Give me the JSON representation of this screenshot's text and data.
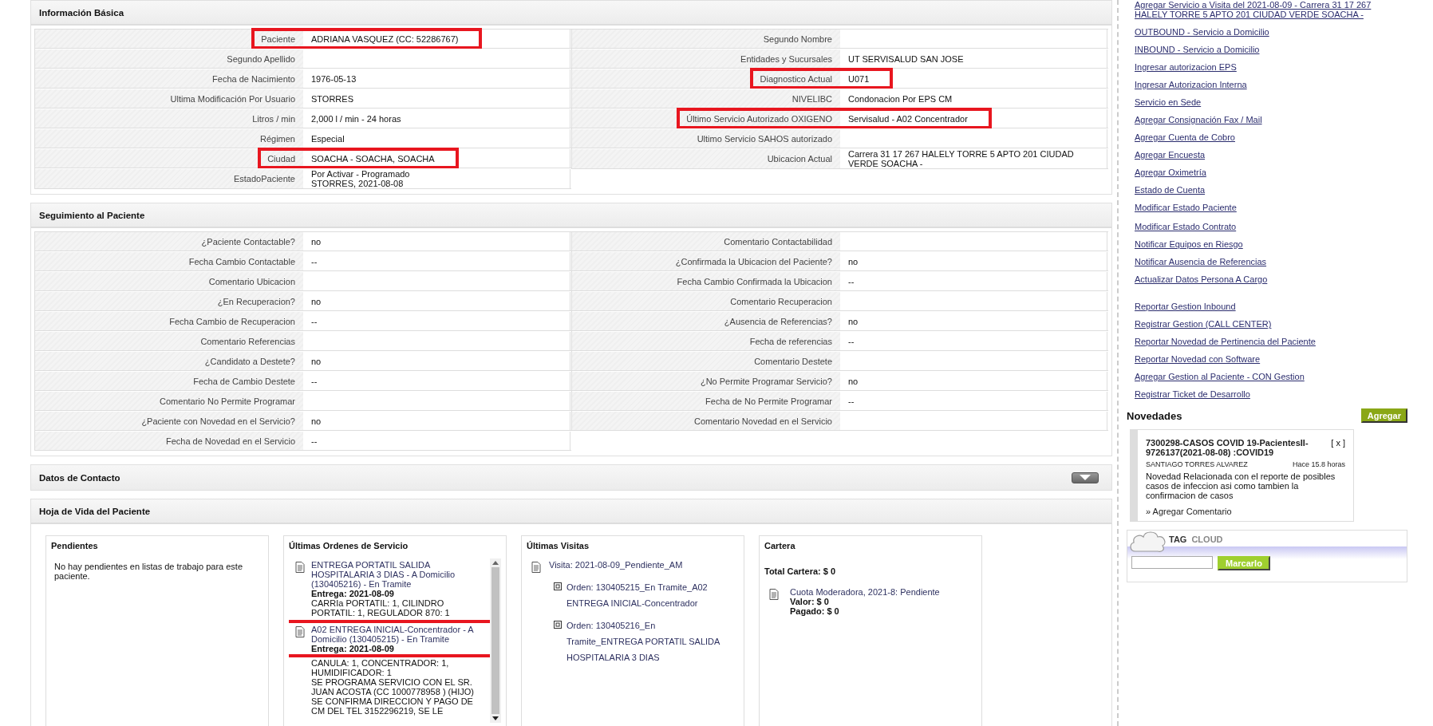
{
  "basic_info": {
    "title": "Información Básica",
    "left": [
      {
        "label": "Paciente",
        "value": "ADRIANA VASQUEZ (CC: 52286767)",
        "highlighted": true
      },
      {
        "label": "Segundo Apellido",
        "highlighted": false
      },
      {
        "label": "Fecha de Nacimiento",
        "value": "1976-05-13",
        "highlighted": false
      },
      {
        "label": "Ultima Modificación Por Usuario",
        "value": "STORRES",
        "highlighted": false
      },
      {
        "label": "Litros / min",
        "value": "2,000 l / min - 24 horas",
        "highlighted": false
      },
      {
        "label": "Régimen",
        "value": "Especial",
        "highlighted": false
      },
      {
        "label": "Ciudad",
        "value": "SOACHA - SOACHA, SOACHA",
        "highlighted": true
      },
      {
        "label": "EstadoPaciente",
        "value": "Por Activar - Programado\nSTORRES, 2021-08-08",
        "highlighted": false
      }
    ],
    "right": [
      {
        "label": "Segundo Nombre",
        "highlighted": false
      },
      {
        "label": "Entidades y Sucursales",
        "value": "UT SERVISALUD SAN JOSE",
        "highlighted": false
      },
      {
        "label": "Diagnostico Actual",
        "value": "U071",
        "highlighted": true
      },
      {
        "label": "NIVELIBC",
        "value": "Condonacion Por EPS CM",
        "highlighted": false
      },
      {
        "label": "Último Servicio Autorizado OXIGENO",
        "value": "Servisalud - A02 Concentrador",
        "highlighted": true
      },
      {
        "label": "Ultimo Servicio SAHOS autorizado",
        "highlighted": false
      },
      {
        "label": "Ubicacion Actual",
        "value": "Carrera 31 17 267 HALELY TORRE 5 APTO 201 CIUDAD VERDE SOACHA -",
        "highlighted": false
      }
    ]
  },
  "seguimiento": {
    "title": "Seguimiento al Paciente",
    "left": [
      {
        "label": "¿Paciente Contactable?",
        "value": "no"
      },
      {
        "label": "Fecha Cambio Contactable",
        "value": "--"
      },
      {
        "label": "Comentario Ubicacion"
      },
      {
        "label": "¿En Recuperacion?",
        "value": "no"
      },
      {
        "label": "Fecha Cambio de Recuperacion",
        "value": "--"
      },
      {
        "label": "Comentario Referencias"
      },
      {
        "label": "¿Candidato a Destete?",
        "value": "no"
      },
      {
        "label": "Fecha de Cambio Destete",
        "value": "--"
      },
      {
        "label": "Comentario No Permite Programar"
      },
      {
        "label": "¿Paciente con Novedad en el Servicio?",
        "value": "no"
      },
      {
        "label": "Fecha de Novedad en el Servicio",
        "value": "--"
      }
    ],
    "right": [
      {
        "label": "Comentario Contactabilidad"
      },
      {
        "label": "¿Confirmada la Ubicacion del Paciente?",
        "value": "no"
      },
      {
        "label": "Fecha Cambio Confirmada la Ubicacion",
        "value": "--"
      },
      {
        "label": "Comentario Recuperacion"
      },
      {
        "label": "¿Ausencia de Referencias?",
        "value": "no"
      },
      {
        "label": "Fecha de referencias",
        "value": "--"
      },
      {
        "label": "Comentario Destete"
      },
      {
        "label": "¿No Permite Programar Servicio?",
        "value": "no"
      },
      {
        "label": "Fecha de No Permite Programar",
        "value": "--"
      },
      {
        "label": "Comentario Novedad en el Servicio"
      }
    ]
  },
  "datos_contacto": {
    "title": "Datos de Contacto",
    "expanded": false
  },
  "hoja_de_vida": {
    "title": "Hoja de Vida del Paciente",
    "pendientes": {
      "title": "Pendientes",
      "message": "No hay pendientes en listas de trabajo para este paciente."
    },
    "ordenes": {
      "title": "Últimas Ordenes de Servicio",
      "items": [
        {
          "title": "ENTREGA PORTATIL SALIDA HOSPITALARIA 3 DIAS - A Domicilio (130405216) - En Tramite",
          "entrega": "Entrega: 2021-08-09",
          "details": "CARRIa PORTATIL: 1, CILINDRO PORTATIL: 1, REGULADOR 870: 1",
          "highlighted": false
        },
        {
          "title": "A02 ENTREGA INICIAL-Concentrador - A Domicilio (130405215) - En Tramite",
          "entrega": "Entrega: 2021-08-09",
          "details": "CANULA: 1, CONCENTRADOR: 1, HUMIDIFICADOR: 1\nSE PROGRAMA SERVICIO CON EL SR. JUAN ACOSTA (CC 1000778958 ) (HIJO) SE CONFIRMA DIRECCION Y PAGO DE CM DEL TEL 3152296219, SE LE",
          "highlighted": true
        }
      ]
    },
    "visitas": {
      "title": "Últimas Visitas",
      "visit": "Visita: 2021-08-09_Pendiente_AM",
      "orders": [
        "Orden: 130405215_En Tramite_A02 ENTREGA INICIAL-Concentrador",
        "Orden: 130405216_En Tramite_ENTREGA PORTATIL SALIDA HOSPITALARIA 3 DIAS"
      ]
    },
    "cartera": {
      "title": "Cartera",
      "total": "Total Cartera: $ 0",
      "items": [
        {
          "title": "Cuota Moderadora, 2021-8: Pendiente",
          "valor": "Valor: $ 0",
          "pagado": "Pagado: $ 0"
        }
      ]
    }
  },
  "sidebar": {
    "link_groups": [
      [
        "Agregar Servicio a Visita del 2021-08-09 - Carrera 31 17 267 HALELY TORRE 5 APTO 201 CIUDAD VERDE SOACHA -",
        "OUTBOUND - Servicio a Domicilio",
        "INBOUND - Servicio a Domicilio",
        "Ingresar autorizacion EPS",
        "Ingresar Autorizacion Interna",
        "Servicio en Sede",
        "Agregar Consignación Fax / Mail",
        "Agregar Cuenta de Cobro",
        "Agregar Encuesta",
        "Agregar Oximetría",
        "Estado de Cuenta",
        "Modificar Estado Paciente"
      ],
      [
        "Modificar Estado Contrato",
        "Notificar Equipos en Riesgo",
        "Notificar Ausencia de Referencias",
        "Actualizar Datos Persona A Cargo"
      ],
      [
        "Reportar Gestion Inbound",
        "Registrar Gestion (CALL CENTER)",
        "Reportar Novedad de Pertinencia del Paciente",
        "Reportar Novedad con Software",
        "Agregar Gestion al Paciente - CON Gestion",
        "Registrar Ticket de Desarrollo"
      ]
    ],
    "novedades": {
      "title": "Novedades",
      "add_button": "Agregar",
      "items": [
        {
          "title": "7300298-CASOS COVID 19-PacientesII-9726137(2021-08-08) :COVID19",
          "close": "[ x ]",
          "author": "SANTIAGO TORRES ALVAREZ",
          "time": "Hace 15.8 horas",
          "body": "Novedad Relacionada con el reporte de posibles casos de infeccion asi como tambien la confirmacion de casos",
          "comment_link": "» Agregar Comentario"
        }
      ]
    },
    "tag_cloud": {
      "title_a": "TAG",
      "title_b": "CLOUD",
      "button": "Marcarlo"
    }
  }
}
